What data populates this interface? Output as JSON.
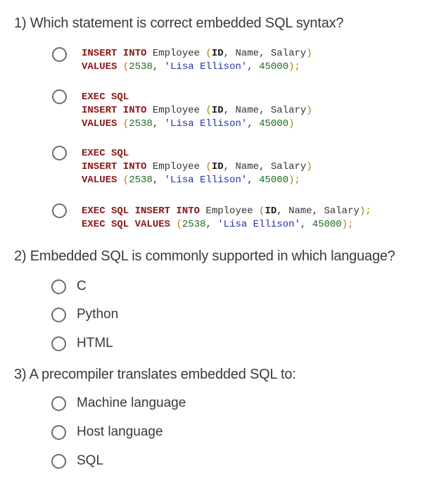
{
  "questions": [
    {
      "title": "1) Which statement is correct embedded SQL syntax?",
      "options": [
        {
          "lines": [
            [
              "INSERT INTO",
              " Employee ",
              "(",
              "ID",
              ", Name, Salary",
              ")"
            ],
            [
              "VALUES",
              " ",
              "(",
              "2538",
              ", ",
              "'Lisa Ellison'",
              ", ",
              "45000",
              ");"
            ]
          ]
        },
        {
          "lines": [
            [
              "EXEC SQL"
            ],
            [
              "INSERT INTO",
              " Employee ",
              "(",
              "ID",
              ", Name, Salary",
              ")"
            ],
            [
              "VALUES",
              " ",
              "(",
              "2538",
              ", ",
              "'Lisa Ellison'",
              ", ",
              "45000",
              ")"
            ]
          ]
        },
        {
          "lines": [
            [
              "EXEC SQL"
            ],
            [
              "INSERT INTO",
              " Employee ",
              "(",
              "ID",
              ", Name, Salary",
              ")"
            ],
            [
              "VALUES",
              " ",
              "(",
              "2538",
              ", ",
              "'Lisa Ellison'",
              ", ",
              "45000",
              ");"
            ]
          ]
        },
        {
          "lines": [
            [
              "EXEC SQL INSERT INTO",
              " Employee ",
              "(",
              "ID",
              ", Name, Salary",
              ");"
            ],
            [
              "EXEC SQL VALUES",
              " ",
              "(",
              "2538",
              ", ",
              "'Lisa Ellison'",
              ", ",
              "45000",
              ");"
            ]
          ]
        }
      ]
    },
    {
      "title": "2) Embedded SQL is commonly supported in which language?",
      "options": [
        "C",
        "Python",
        "HTML"
      ]
    },
    {
      "title": "3) A precompiler translates embedded SQL to:",
      "options": [
        "Machine language",
        "Host language",
        "SQL"
      ]
    }
  ]
}
